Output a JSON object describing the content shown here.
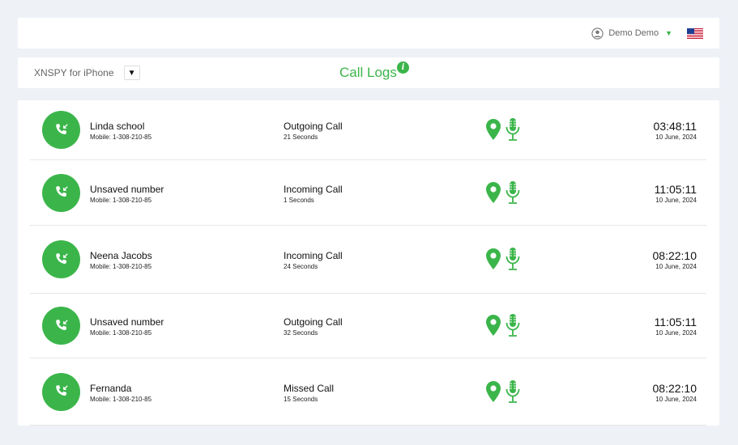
{
  "header": {
    "user_name": "Demo Demo",
    "user_icon": "user-circle-icon",
    "caret_icon": "caret-down-icon",
    "flag_icon": "us-flag-icon"
  },
  "subheader": {
    "device_label": "XNSPY for iPhone",
    "device_toggle": "▼",
    "title": "Call Logs",
    "info_icon": "i"
  },
  "colors": {
    "accent": "#3bb54a",
    "background": "#eef1f6"
  },
  "calls": [
    {
      "name": "Linda school",
      "mobile": "Mobile: 1-308-210-85",
      "type": "Outgoing Call",
      "duration": "21 Seconds",
      "time": "03:48:11",
      "date": "10 June, 2024"
    },
    {
      "name": "Unsaved number",
      "mobile": "Mobile: 1-308-210-85",
      "type": "Incoming Call",
      "duration": "1 Seconds",
      "time": "11:05:11",
      "date": "10 June, 2024"
    },
    {
      "name": "Neena Jacobs",
      "mobile": "Mobile: 1-308-210-85",
      "type": "Incoming Call",
      "duration": "24 Seconds",
      "time": "08:22:10",
      "date": "10 June, 2024"
    },
    {
      "name": "Unsaved number",
      "mobile": "Mobile: 1-308-210-85",
      "type": "Outgoing Call",
      "duration": "32 Seconds",
      "time": "11:05:11",
      "date": "10 June, 2024"
    },
    {
      "name": "Fernanda",
      "mobile": "Mobile: 1-308-210-85",
      "type": "Missed Call",
      "duration": "15 Seconds",
      "time": "08:22:10",
      "date": "10 June, 2024"
    }
  ]
}
